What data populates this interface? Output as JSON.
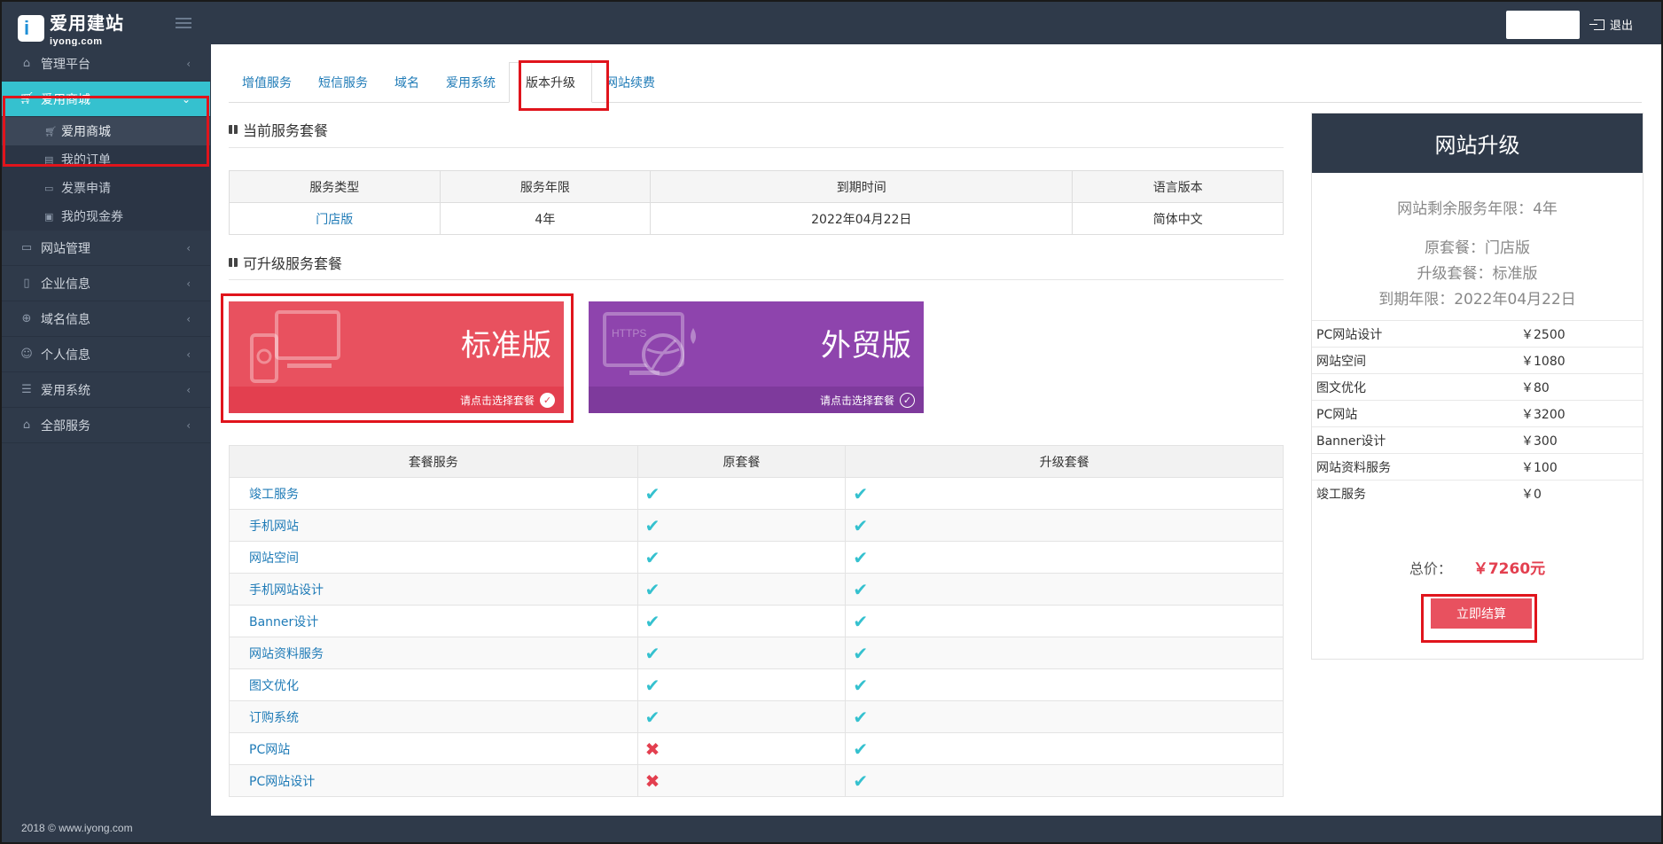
{
  "app": {
    "logo_cn": "爱用建站",
    "logo_en": "iyong.com",
    "logout_label": "退出",
    "footer": "2018 © www.iyong.com"
  },
  "sidebar": {
    "items": [
      {
        "label": "管理平台",
        "icon": "home-icon"
      },
      {
        "label": "爱用商城",
        "icon": "cart-icon",
        "active": true
      },
      {
        "label": "网站管理",
        "icon": "laptop-icon"
      },
      {
        "label": "企业信息",
        "icon": "building-icon"
      },
      {
        "label": "域名信息",
        "icon": "globe-icon"
      },
      {
        "label": "个人信息",
        "icon": "user-icon"
      },
      {
        "label": "爱用系统",
        "icon": "list-icon"
      },
      {
        "label": "全部服务",
        "icon": "bag-icon"
      }
    ],
    "sub_items": [
      {
        "label": "爱用商城",
        "icon": "cart-icon",
        "active": true
      },
      {
        "label": "我的订单",
        "icon": "document-icon"
      },
      {
        "label": "发票申请",
        "icon": "invoice-icon"
      },
      {
        "label": "我的现金券",
        "icon": "coupon-icon"
      }
    ]
  },
  "tabs": [
    "增值服务",
    "短信服务",
    "域名",
    "爱用系统",
    "版本升级",
    "网站续费"
  ],
  "current": {
    "title": "当前服务套餐",
    "headers": [
      "服务类型",
      "服务年限",
      "到期时间",
      "语言版本"
    ],
    "row": [
      "门店版",
      "4年",
      "2022年04月22日",
      "简体中文"
    ]
  },
  "upgrade": {
    "title": "可升级服务套餐",
    "packages": [
      {
        "name": "标准版",
        "hint": "请点击选择套餐"
      },
      {
        "name": "外贸版",
        "hint": "请点击选择套餐",
        "icon_text": "HTTPS"
      }
    ]
  },
  "compare": {
    "headers": [
      "套餐服务",
      "原套餐",
      "升级套餐"
    ],
    "rows": [
      {
        "service": "竣工服务",
        "original": "yes",
        "upgrade": "yes"
      },
      {
        "service": "手机网站",
        "original": "yes",
        "upgrade": "yes"
      },
      {
        "service": "网站空间",
        "original": "yes",
        "upgrade": "yes"
      },
      {
        "service": "手机网站设计",
        "original": "yes",
        "upgrade": "yes"
      },
      {
        "service": "Banner设计",
        "original": "yes",
        "upgrade": "yes"
      },
      {
        "service": "网站资料服务",
        "original": "yes",
        "upgrade": "yes"
      },
      {
        "service": "图文优化",
        "original": "yes",
        "upgrade": "yes"
      },
      {
        "service": "订购系统",
        "original": "yes",
        "upgrade": "yes"
      },
      {
        "service": "PC网站",
        "original": "no",
        "upgrade": "yes"
      },
      {
        "service": "PC网站设计",
        "original": "no",
        "upgrade": "yes"
      }
    ]
  },
  "panel": {
    "title": "网站升级",
    "remaining": "网站剩余服务年限：4年",
    "original_pkg": "原套餐：门店版",
    "upgrade_pkg": "升级套餐：标准版",
    "expiry": "到期年限：2022年04月22日",
    "prices": [
      {
        "item": "PC网站设计",
        "price": "￥2500"
      },
      {
        "item": "网站空间",
        "price": "￥1080"
      },
      {
        "item": "图文优化",
        "price": "￥80"
      },
      {
        "item": "PC网站",
        "price": "￥3200"
      },
      {
        "item": "Banner设计",
        "price": "￥300"
      },
      {
        "item": "网站资料服务",
        "price": "￥100"
      },
      {
        "item": "竣工服务",
        "price": "￥0"
      }
    ],
    "total_label": "总价：",
    "total_amount": "￥7260元",
    "pay_button": "立即结算"
  },
  "colors": {
    "accent": "#35c1cf",
    "dark": "#2f3a4a",
    "red": "#e33f4f",
    "purple": "#8e44ad",
    "link": "#1f7bb7"
  }
}
